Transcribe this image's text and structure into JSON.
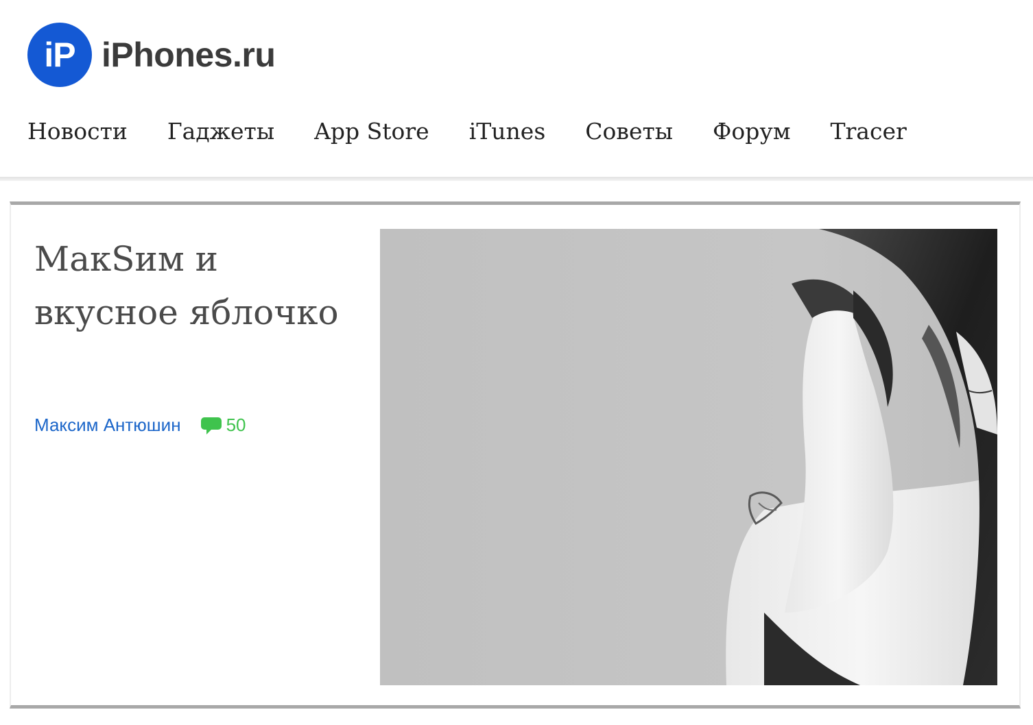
{
  "site": {
    "logo_badge": "iP",
    "logo_text": "iPhones.ru",
    "brand_color": "#1459d4"
  },
  "nav": {
    "items": [
      {
        "label": "Новости"
      },
      {
        "label": "Гаджеты"
      },
      {
        "label": "App Store"
      },
      {
        "label": "iTunes"
      },
      {
        "label": "Советы"
      },
      {
        "label": "Форум"
      },
      {
        "label": "Tracer"
      }
    ]
  },
  "article": {
    "title": "МакSим и вкусное яблочко",
    "author": "Максим Антюшин",
    "comments_count": "50",
    "comment_icon": "speech-bubble-icon",
    "author_color": "#1c66c9",
    "comments_color": "#3fc34d",
    "image": {
      "style": "black-and-white photo"
    }
  }
}
